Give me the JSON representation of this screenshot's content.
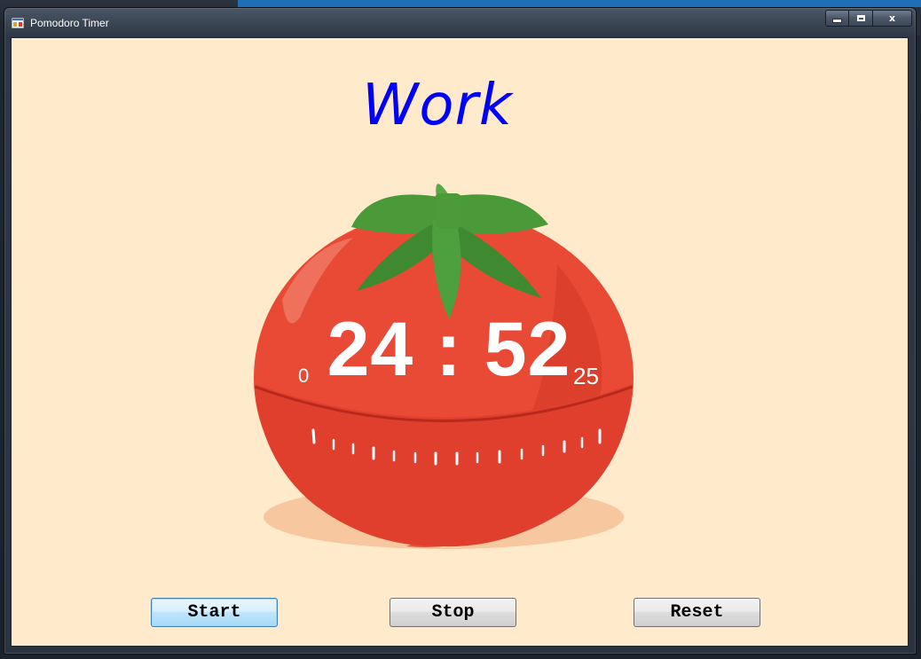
{
  "window": {
    "title": "Pomodoro Timer",
    "caption_buttons": {
      "minimize": "minimize-icon",
      "maximize": "maximize-icon",
      "close": "x"
    }
  },
  "timer": {
    "mode": "Work",
    "minutes": "24",
    "separator": ":",
    "seconds": "52",
    "scale_min": "0",
    "scale_max": "25",
    "remaining_fraction": 0.9947
  },
  "buttons": {
    "start": "Start",
    "stop": "Stop",
    "reset": "Reset"
  },
  "colors": {
    "client_background": "#ffebcc",
    "mode_text": "#0000ff",
    "tomato": "#e84a36",
    "leaf": "#4e9a3a",
    "timer_text": "#ffffff"
  }
}
